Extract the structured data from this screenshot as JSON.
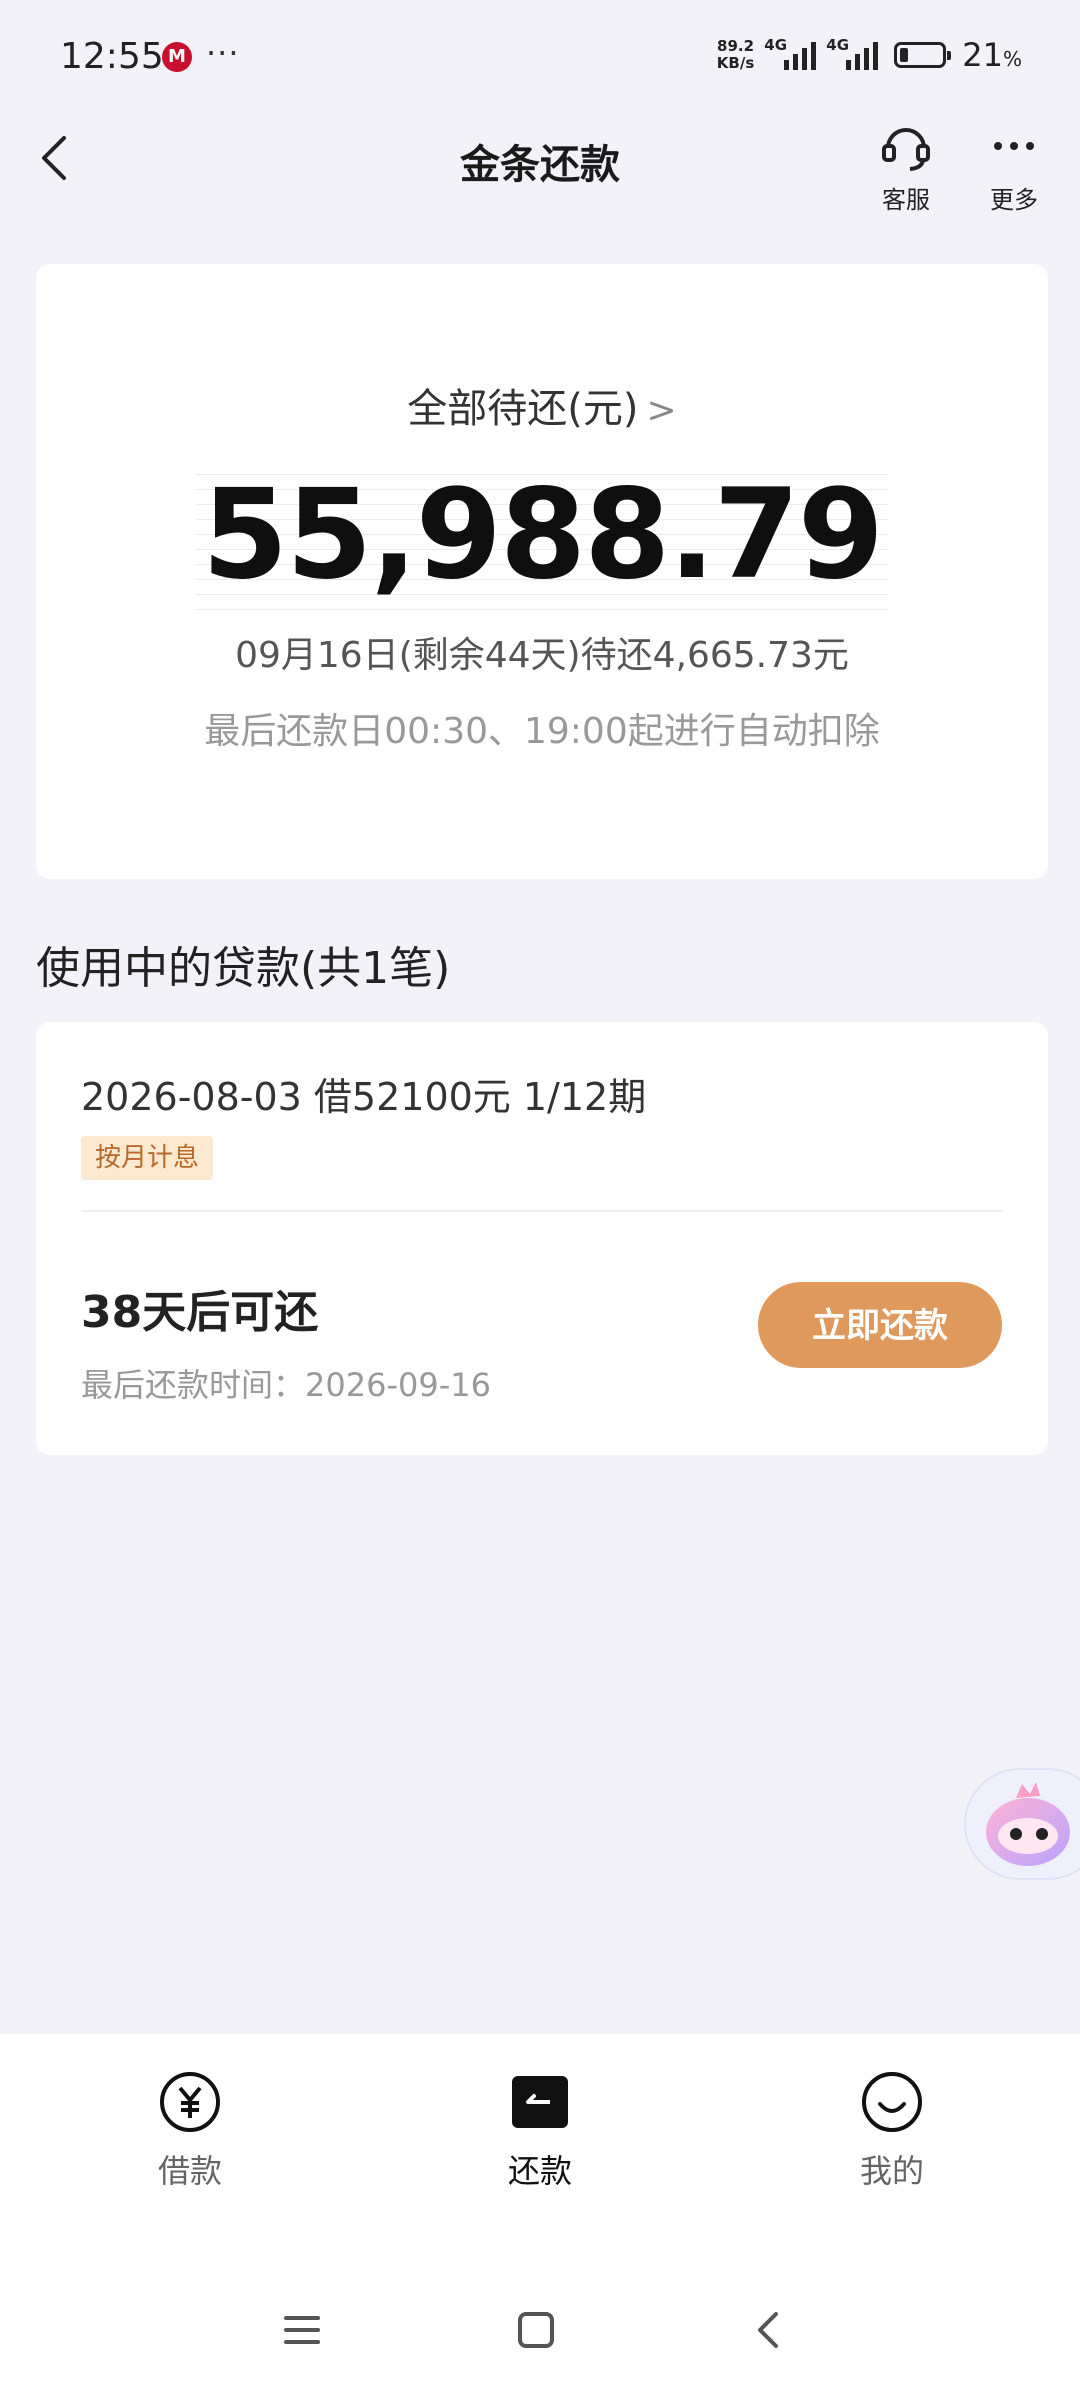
{
  "status": {
    "time": "12:55",
    "app_badge": "M",
    "overflow": "···",
    "net_speed_value": "89.2",
    "net_speed_unit": "KB/s",
    "sim1_tag": "4G",
    "sim2_tag": "4G",
    "battery_level": 0.21,
    "battery_percent": "21",
    "battery_unit": "%"
  },
  "nav": {
    "title": "金条还款",
    "customer_service_label": "客服",
    "more_label": "更多"
  },
  "summary": {
    "label": "全部待还(元)",
    "amount": "55,988.79",
    "due_line": "09月16日(剩余44天)待还4,665.73元",
    "auto_debit_note": "最后还款日00:30、19:00起进行自动扣除"
  },
  "loans": {
    "section_title": "使用中的贷款(共1笔)",
    "items": [
      {
        "summary": "2026-08-03 借52100元 1/12期",
        "badge": "按月计息",
        "days_until": "38天后可还",
        "deadline": "最后还款时间：2026-09-16",
        "repay_button": "立即还款"
      }
    ]
  },
  "tabs": [
    {
      "label": "借款",
      "icon": "yuan-icon"
    },
    {
      "label": "还款",
      "icon": "repay-icon",
      "active": true
    },
    {
      "label": "我的",
      "icon": "smile-icon"
    }
  ],
  "colors": {
    "accent": "#e0995c",
    "badge_bg": "#fde9cf",
    "badge_text": "#b6692a",
    "page_bg": "#f2f2f8"
  }
}
